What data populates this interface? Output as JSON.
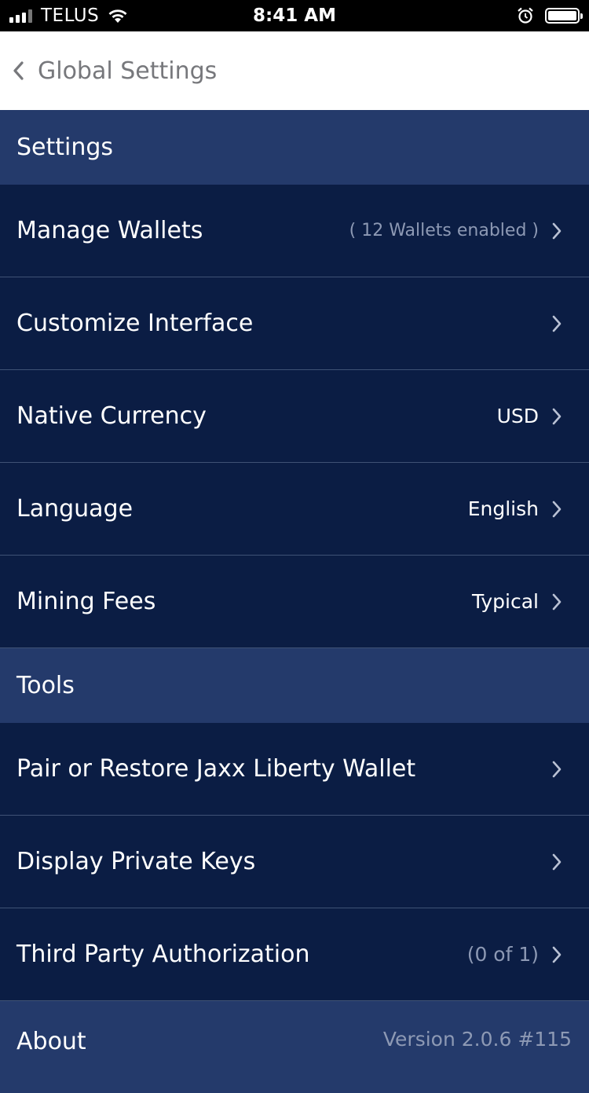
{
  "status_bar": {
    "carrier": "TELUS",
    "time": "8:41 AM"
  },
  "header": {
    "title": "Global Settings"
  },
  "sections": {
    "settings": {
      "title": "Settings",
      "manage_wallets": {
        "label": "Manage Wallets",
        "value": "( 12 Wallets enabled )"
      },
      "customize_interface": {
        "label": "Customize Interface"
      },
      "native_currency": {
        "label": "Native Currency",
        "value": "USD"
      },
      "language": {
        "label": "Language",
        "value": "English"
      },
      "mining_fees": {
        "label": "Mining Fees",
        "value": "Typical"
      }
    },
    "tools": {
      "title": "Tools",
      "pair_restore": {
        "label": "Pair or Restore Jaxx Liberty Wallet"
      },
      "private_keys": {
        "label": "Display Private Keys"
      },
      "third_party": {
        "label": "Third Party Authorization",
        "value": "(0 of 1)"
      }
    },
    "about": {
      "label": "About",
      "value": "Version 2.0.6 #115"
    }
  },
  "colors": {
    "row_bg": "#0b1d44",
    "section_bg": "#243a6b",
    "divider": "#3f5275",
    "muted_text": "#8d99b4"
  },
  "icons": [
    "signal-icon",
    "wifi-icon",
    "alarm-icon",
    "battery-icon",
    "back-chevron-icon",
    "chevron-right-icon"
  ]
}
